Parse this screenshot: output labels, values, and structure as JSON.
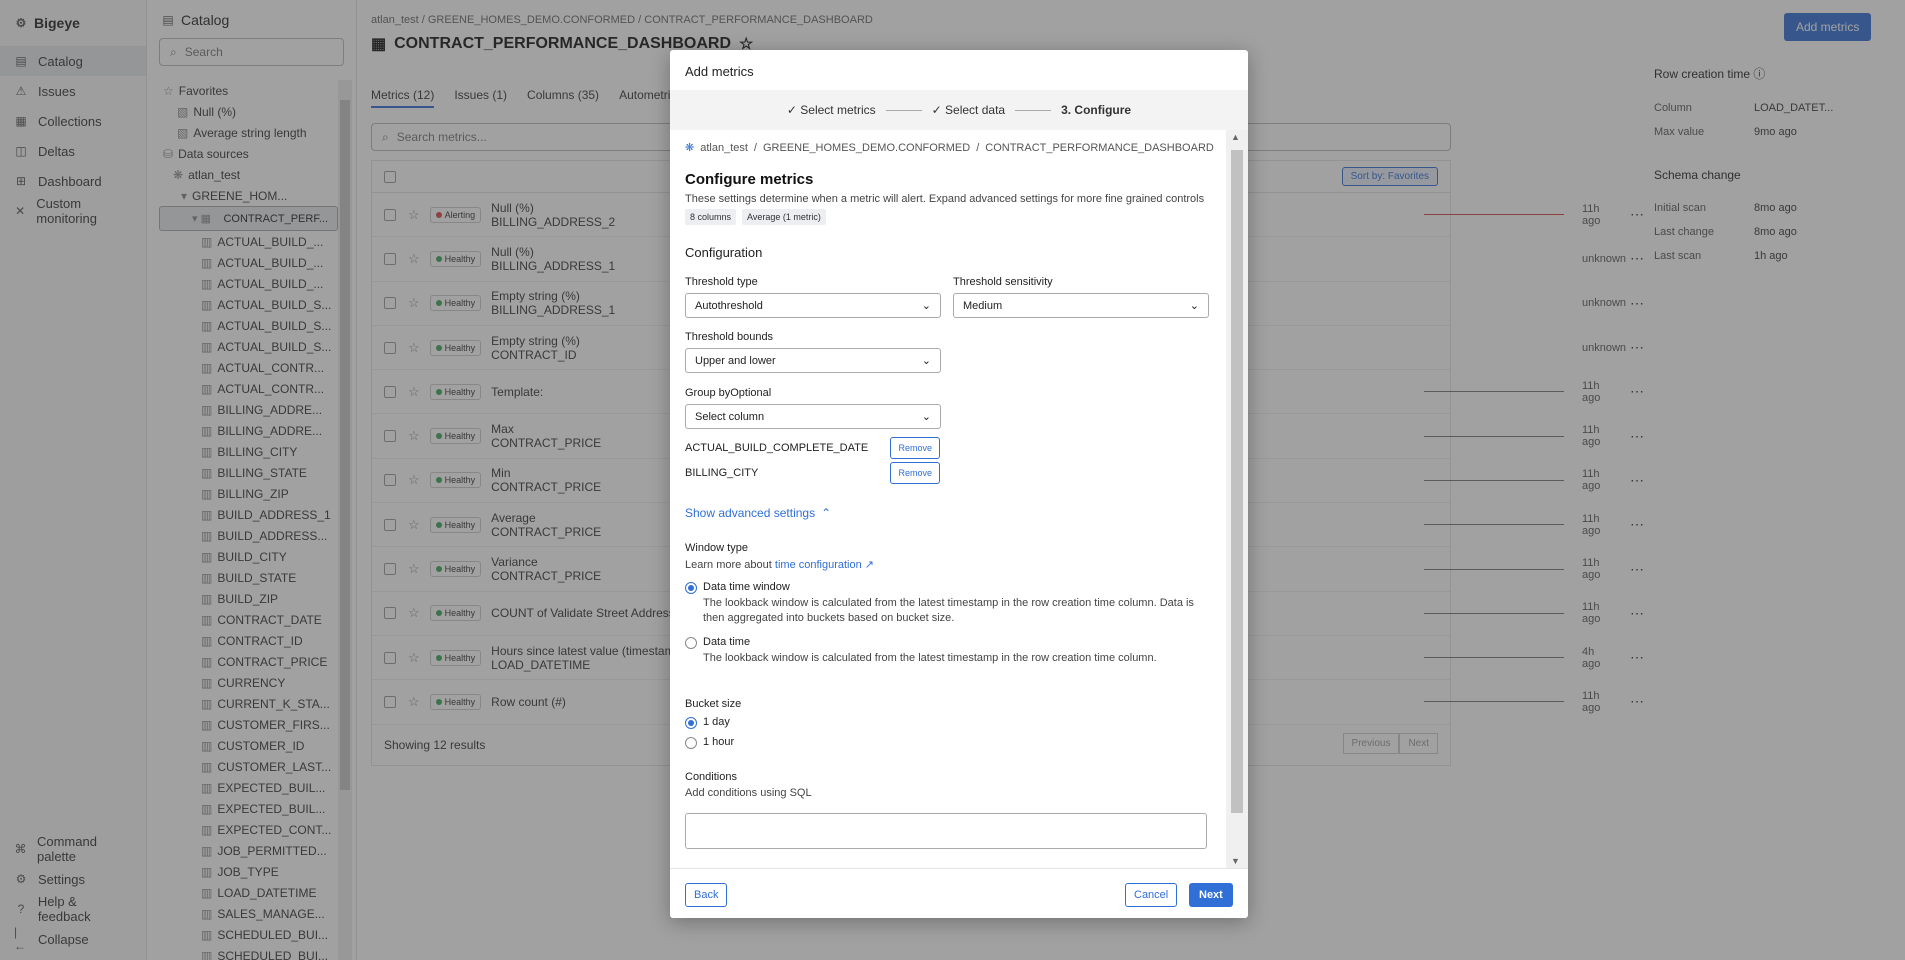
{
  "app": {
    "name": "Bigeye",
    "nav": [
      {
        "label": "Catalog",
        "icon": "catalog-icon"
      },
      {
        "label": "Issues",
        "icon": "issues-icon"
      },
      {
        "label": "Collections",
        "icon": "collections-icon"
      },
      {
        "label": "Deltas",
        "icon": "deltas-icon"
      },
      {
        "label": "Dashboard",
        "icon": "dashboard-icon"
      },
      {
        "label": "Custom monitoring",
        "icon": "custom-monitoring-icon"
      }
    ],
    "nav_bottom": [
      {
        "label": "Command palette",
        "icon": "command-icon"
      },
      {
        "label": "Settings",
        "icon": "gear-icon"
      },
      {
        "label": "Help & feedback",
        "icon": "help-icon"
      },
      {
        "label": "Collapse",
        "icon": "collapse-icon"
      }
    ]
  },
  "catalog": {
    "title": "Catalog",
    "search_placeholder": "Search",
    "tree": [
      "Favorites",
      "Null (%)",
      "Average string length",
      "Data sources",
      "atlan_test",
      "GREENE_HOM...",
      "CONTRACT_PERF...",
      "ACTUAL_BUILD_...",
      "ACTUAL_BUILD_...",
      "ACTUAL_BUILD_...",
      "ACTUAL_BUILD_S...",
      "ACTUAL_BUILD_S...",
      "ACTUAL_BUILD_S...",
      "ACTUAL_CONTR...",
      "ACTUAL_CONTR...",
      "BILLING_ADDRE...",
      "BILLING_ADDRE...",
      "BILLING_CITY",
      "BILLING_STATE",
      "BILLING_ZIP",
      "BUILD_ADDRESS_1",
      "BUILD_ADDRESS...",
      "BUILD_CITY",
      "BUILD_STATE",
      "BUILD_ZIP",
      "CONTRACT_DATE",
      "CONTRACT_ID",
      "CONTRACT_PRICE",
      "CURRENCY",
      "CURRENT_K_STA...",
      "CUSTOMER_FIRS...",
      "CUSTOMER_ID",
      "CUSTOMER_LAST...",
      "EXPECTED_BUIL...",
      "EXPECTED_BUIL...",
      "EXPECTED_CONT...",
      "JOB_PERMITTED...",
      "JOB_TYPE",
      "LOAD_DATETIME",
      "SALES_MANAGE...",
      "SCHEDULED_BUI...",
      "SCHEDULED_BUI..."
    ]
  },
  "page": {
    "breadcrumb": [
      "atlan_test",
      "GREENE_HOMES_DEMO.CONFORMED",
      "CONTRACT_PERFORMANCE_DASHBOARD"
    ],
    "title": "CONTRACT_PERFORMANCE_DASHBOARD",
    "add_metrics": "Add metrics",
    "tabs": [
      "Metrics (12)",
      "Issues (1)",
      "Columns (35)",
      "Autometric"
    ],
    "search_placeholder": "Search metrics...",
    "sort_label": "Sort by: Favorites",
    "metrics": [
      {
        "status": "Alerting",
        "name": "Null (%)",
        "column": "BILLING_ADDRESS_2",
        "time": "11h ago",
        "color": "#d64545"
      },
      {
        "status": "Healthy",
        "name": "Null (%)",
        "column": "BILLING_ADDRESS_1",
        "time": "unknown",
        "color": "#3aa655"
      },
      {
        "status": "Healthy",
        "name": "Empty string (%)",
        "column": "BILLING_ADDRESS_1",
        "time": "unknown",
        "color": "#3aa655"
      },
      {
        "status": "Healthy",
        "name": "Empty string (%)",
        "column": "CONTRACT_ID",
        "time": "unknown",
        "color": "#3aa655"
      },
      {
        "status": "Healthy",
        "name": "Template:",
        "column": "",
        "time": "11h ago",
        "color": "#3aa655"
      },
      {
        "status": "Healthy",
        "name": "Max",
        "column": "CONTRACT_PRICE",
        "time": "11h ago",
        "color": "#3aa655"
      },
      {
        "status": "Healthy",
        "name": "Min",
        "column": "CONTRACT_PRICE",
        "time": "11h ago",
        "color": "#3aa655"
      },
      {
        "status": "Healthy",
        "name": "Average",
        "column": "CONTRACT_PRICE",
        "time": "11h ago",
        "color": "#3aa655"
      },
      {
        "status": "Healthy",
        "name": "Variance",
        "column": "CONTRACT_PRICE",
        "time": "11h ago",
        "color": "#3aa655"
      },
      {
        "status": "Healthy",
        "name": "COUNT of Validate Street Address",
        "column": "",
        "time": "11h ago",
        "color": "#3aa655"
      },
      {
        "status": "Healthy",
        "name": "Hours since latest value (timestamp)",
        "column": "LOAD_DATETIME",
        "time": "4h ago",
        "color": "#3aa655"
      },
      {
        "status": "Healthy",
        "name": "Row count (#)",
        "column": "",
        "time": "11h ago",
        "color": "#3aa655"
      }
    ],
    "results": "Showing 12 results",
    "prev": "Previous",
    "next": "Next"
  },
  "side": {
    "row_creation_title": "Row creation time",
    "column_label": "Column",
    "column_value": "LOAD_DATET...",
    "max_label": "Max value",
    "max_value": "9mo ago",
    "schema_title": "Schema change",
    "initial_label": "Initial scan",
    "initial_value": "8mo ago",
    "last_change_label": "Last change",
    "last_change_value": "8mo ago",
    "last_scan_label": "Last scan",
    "last_scan_value": "1h ago"
  },
  "modal": {
    "title": "Add metrics",
    "steps": [
      "Select metrics",
      "Select data",
      "3. Configure"
    ],
    "breadcrumb": [
      "atlan_test",
      "GREENE_HOMES_DEMO.CONFORMED",
      "CONTRACT_PERFORMANCE_DASHBOARD"
    ],
    "heading": "Configure metrics",
    "description": "These settings determine when a metric will alert. Expand advanced settings for more fine grained controls",
    "chips": [
      "8 columns",
      "Average (1 metric)"
    ],
    "section": "Configuration",
    "threshold_type_label": "Threshold type",
    "threshold_type_value": "Autothreshold",
    "sensitivity_label": "Threshold sensitivity",
    "sensitivity_value": "Medium",
    "bounds_label": "Threshold bounds",
    "bounds_value": "Upper and lower",
    "group_by_label": "Group by",
    "optional": "Optional",
    "group_by_placeholder": "Select column",
    "group_columns": [
      "ACTUAL_BUILD_COMPLETE_DATE",
      "BILLING_CITY"
    ],
    "remove": "Remove",
    "advanced": "Show advanced settings",
    "window_type": "Window type",
    "learn_prefix": "Learn more about",
    "learn_link": "time configuration",
    "radio1_label": "Data time window",
    "radio1_desc": "The lookback window is calculated from the latest timestamp in the row creation time column. Data is then aggregated into buckets based on bucket size.",
    "radio2_label": "Data time",
    "radio2_desc": "The lookback window is calculated from the latest timestamp in the row creation time column.",
    "bucket_label": "Bucket size",
    "bucket1": "1 day",
    "bucket2": "1 hour",
    "conditions_label": "Conditions",
    "conditions_sub": "Add conditions using SQL",
    "back": "Back",
    "cancel": "Cancel",
    "next": "Next"
  }
}
